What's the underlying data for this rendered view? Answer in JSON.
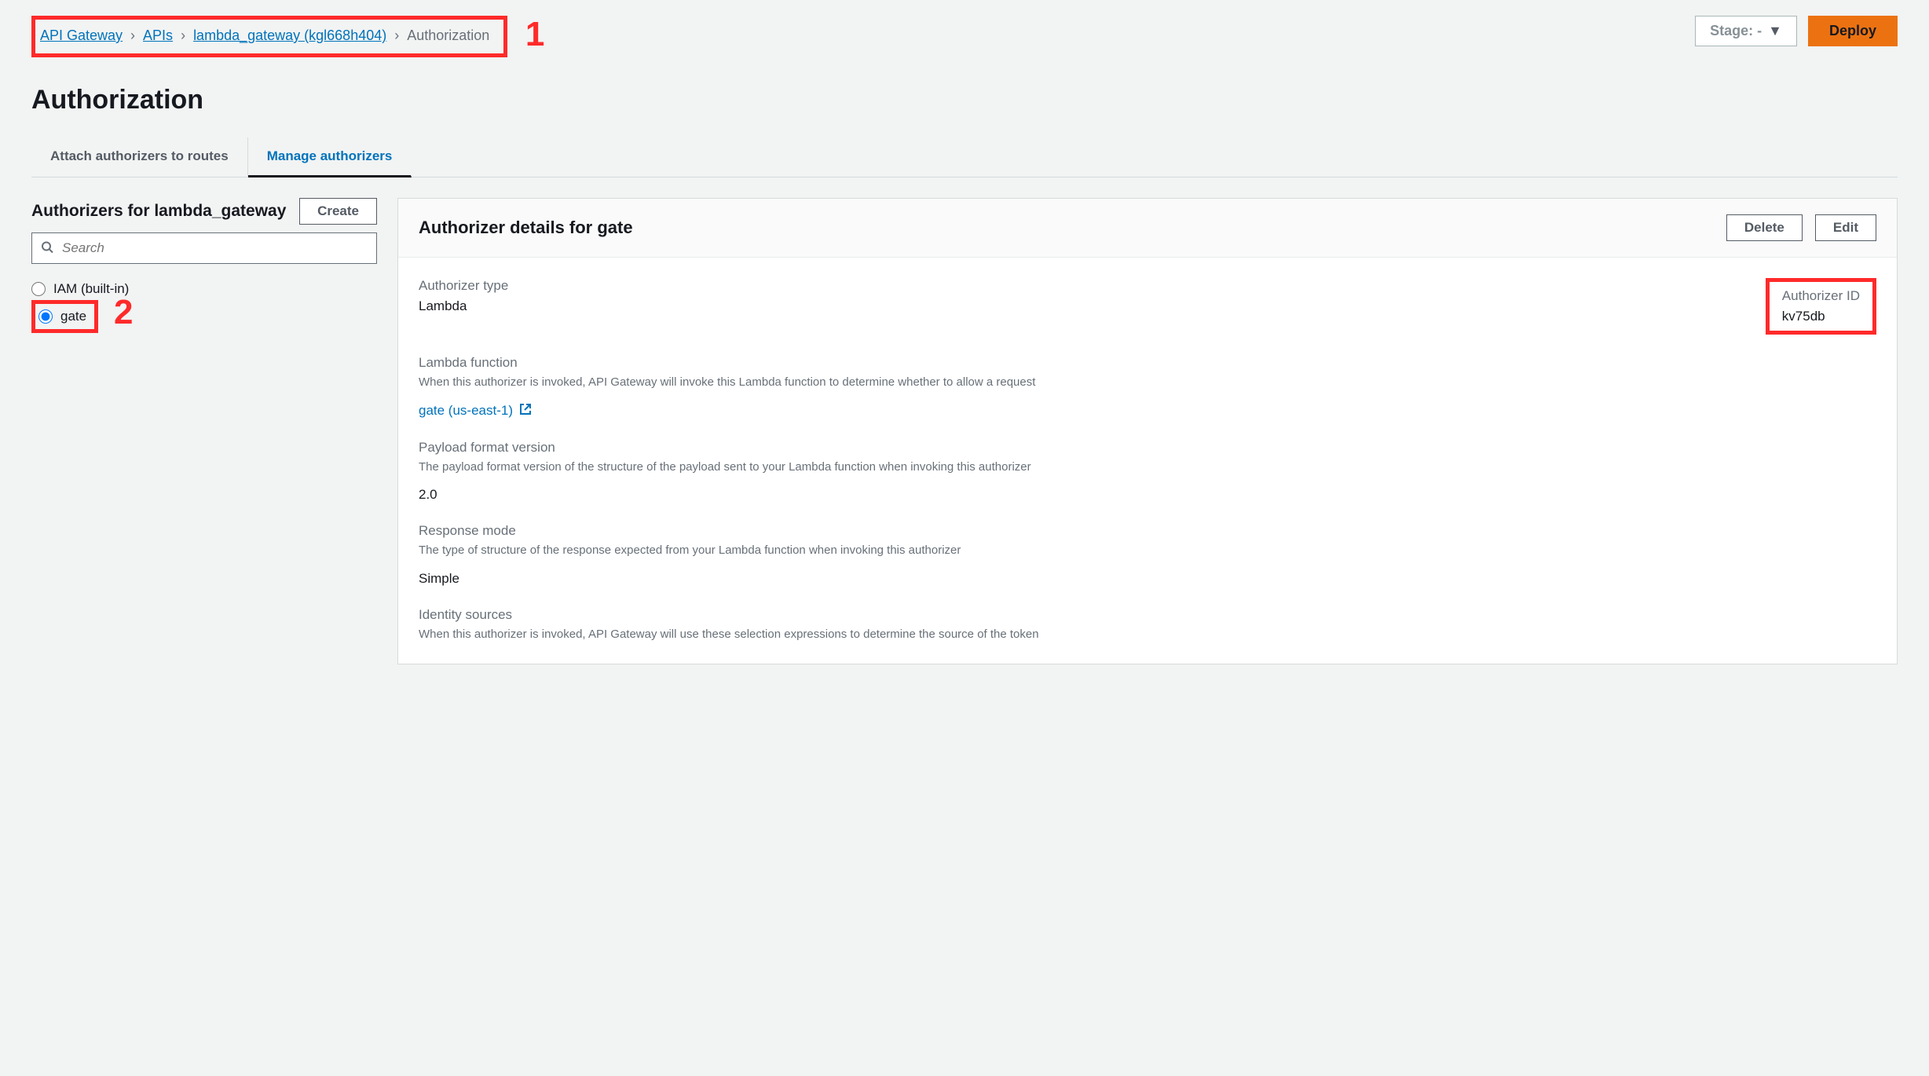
{
  "breadcrumb": {
    "items": [
      {
        "label": "API Gateway",
        "link": true
      },
      {
        "label": "APIs",
        "link": true
      },
      {
        "label": "lambda_gateway (kgl668h404)",
        "link": true
      },
      {
        "label": "Authorization",
        "link": false
      }
    ]
  },
  "annotations": {
    "one": "1",
    "two": "2"
  },
  "top_actions": {
    "stage_label": "Stage: -",
    "deploy_label": "Deploy"
  },
  "page_title": "Authorization",
  "tabs": {
    "attach": "Attach authorizers to routes",
    "manage": "Manage authorizers"
  },
  "left": {
    "title": "Authorizers for lambda_gateway",
    "create_label": "Create",
    "search_placeholder": "Search",
    "options": {
      "iam": "IAM (built-in)",
      "gate": "gate"
    }
  },
  "details": {
    "title": "Authorizer details for gate",
    "delete_label": "Delete",
    "edit_label": "Edit",
    "type_label": "Authorizer type",
    "type_value": "Lambda",
    "id_label": "Authorizer ID",
    "id_value": "kv75db",
    "lambda": {
      "title": "Lambda function",
      "desc": "When this authorizer is invoked, API Gateway will invoke this Lambda function to determine whether to allow a request",
      "link": "gate (us-east-1)"
    },
    "payload": {
      "title": "Payload format version",
      "desc": "The payload format version of the structure of the payload sent to your Lambda function when invoking this authorizer",
      "value": "2.0"
    },
    "response": {
      "title": "Response mode",
      "desc": "The type of structure of the response expected from your Lambda function when invoking this authorizer",
      "value": "Simple"
    },
    "identity": {
      "title": "Identity sources",
      "desc": "When this authorizer is invoked, API Gateway will use these selection expressions to determine the source of the token"
    }
  }
}
